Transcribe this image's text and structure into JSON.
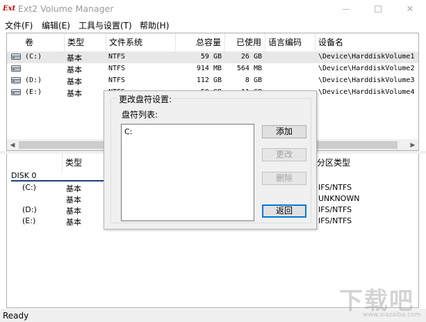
{
  "window": {
    "title": "Ext2 Volume Manager",
    "logo_text": "Ext"
  },
  "menu": {
    "items": [
      {
        "label": "文件(F)"
      },
      {
        "label": "编辑(E)"
      },
      {
        "label": "工具与设置(T)"
      },
      {
        "label": "帮助(H)"
      }
    ]
  },
  "volumes": {
    "columns": [
      "卷",
      "类型",
      "文件系统",
      "总容量",
      "已使用",
      "语言编码",
      "设备名"
    ],
    "rows": [
      {
        "volume": "(C:)",
        "type": "基本",
        "fs": "NTFS",
        "total": "59 GB",
        "used": "26 GB",
        "encoding": "",
        "device": "\\Device\\HarddiskVolume1"
      },
      {
        "volume": "",
        "type": "基本",
        "fs": "NTFS",
        "total": "914 MB",
        "used": "564 MB",
        "encoding": "",
        "device": "\\Device\\HarddiskVolume2"
      },
      {
        "volume": "(D:)",
        "type": "基本",
        "fs": "NTFS",
        "total": "112 GB",
        "used": "8 GB",
        "encoding": "",
        "device": "\\Device\\HarddiskVolume3"
      },
      {
        "volume": "(E:)",
        "type": "基本",
        "fs": "NTFS",
        "total": "59 GB",
        "used": "11 GB",
        "encoding": "",
        "device": "\\Device\\HarddiskVolume4"
      }
    ]
  },
  "disks": {
    "columns": [
      "类型",
      "分区类型"
    ],
    "disk_label": "DISK 0",
    "partitions": [
      {
        "volume": "(C:)",
        "type": "基本",
        "ptype": "IFS/NTFS"
      },
      {
        "volume": "",
        "type": "基本",
        "ptype": "UNKNOWN"
      },
      {
        "volume": "(D:)",
        "type": "基本",
        "ptype": "IFS/NTFS"
      },
      {
        "volume": "(E:)",
        "type": "基本",
        "ptype": "IFS/NTFS"
      }
    ]
  },
  "dialog": {
    "group_title": "更改盘符设置:",
    "list_label": "盘符列表:",
    "list_items": [
      "C:"
    ],
    "buttons": {
      "add": "添加",
      "change": "更改",
      "delete": "删除",
      "back": "返回"
    }
  },
  "status": {
    "text": "Ready"
  },
  "watermark": {
    "text": "下载吧",
    "sub": "www.xiazaiba.com"
  }
}
